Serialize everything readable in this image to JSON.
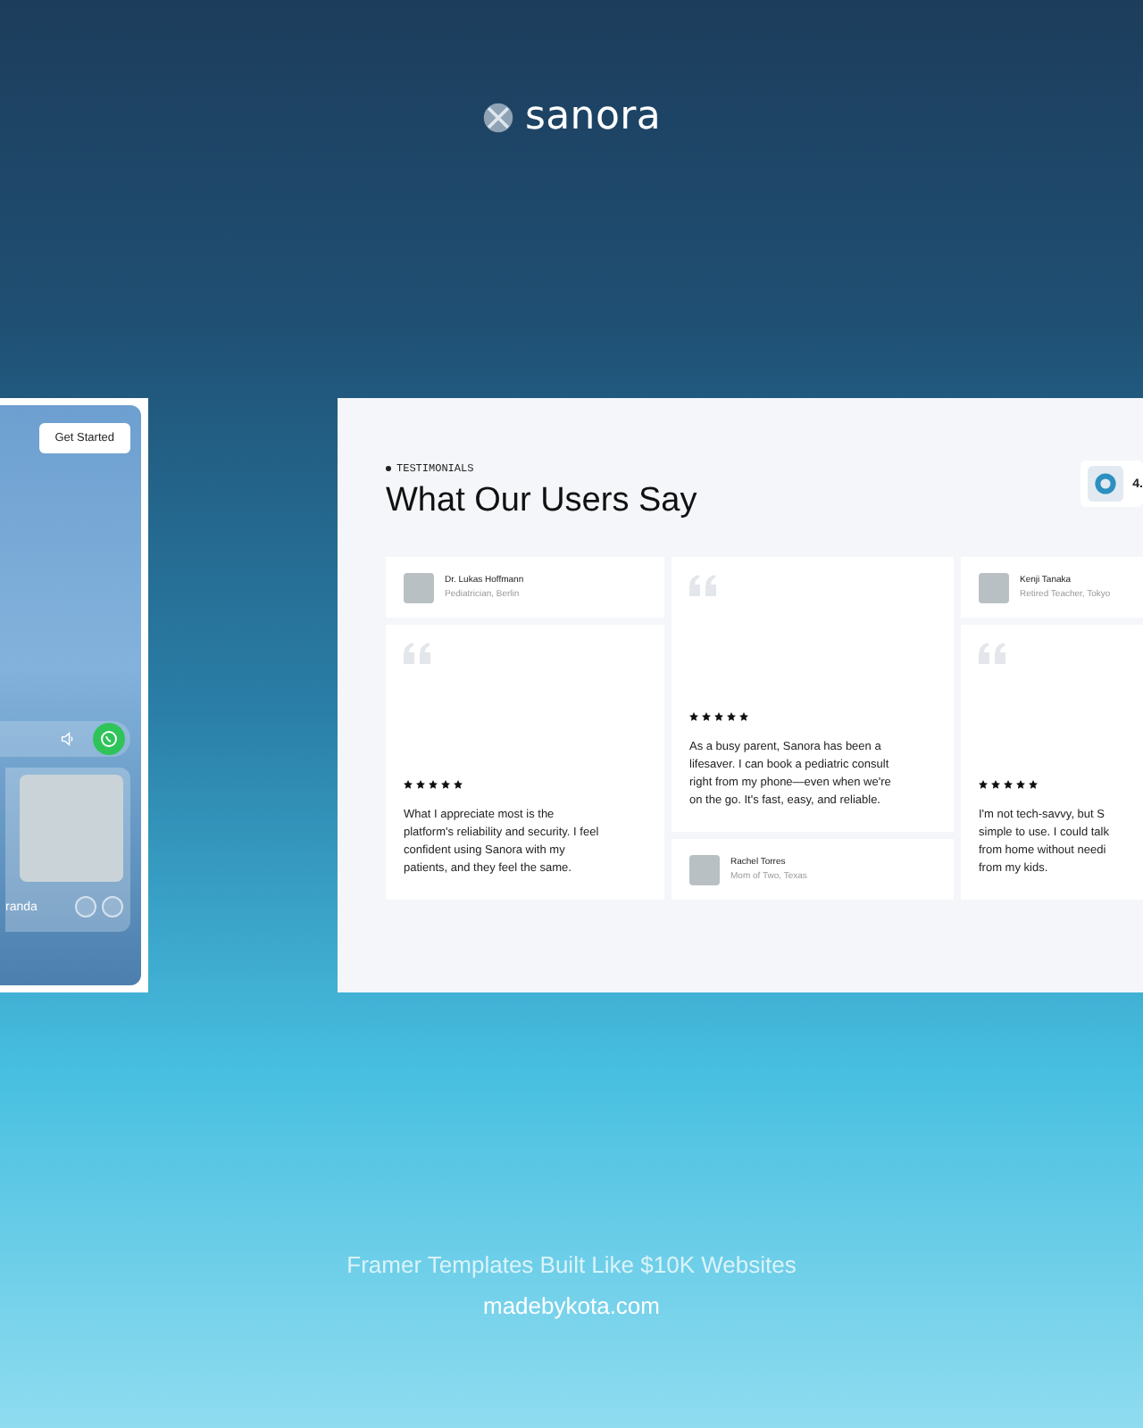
{
  "brand": {
    "name": "sanora"
  },
  "left_preview": {
    "button": "Get Started",
    "call_name": "randa"
  },
  "testimonials": {
    "eyebrow": "TESTIMONIALS",
    "title": "What Our Users Say",
    "rating": "4.",
    "columns": [
      {
        "cards": [
          {
            "kind": "author",
            "name": "Dr. Lukas Hoffmann",
            "role": "Pediatrician, Berlin"
          },
          {
            "kind": "quote",
            "stars": 5,
            "lines": [
              "What I appreciate most is the",
              "platform's reliability and security. I feel",
              "confident using Sanora with my",
              "patients, and they feel the same."
            ]
          }
        ]
      },
      {
        "cards": [
          {
            "kind": "quote",
            "stars": 5,
            "lines": [
              "As a busy parent, Sanora has been a",
              "lifesaver. I can book a pediatric consult",
              "right from my phone—even when we're",
              "on the go. It's fast, easy, and reliable."
            ]
          },
          {
            "kind": "author",
            "name": "Rachel Torres",
            "role": "Mom of Two, Texas"
          }
        ]
      },
      {
        "cards": [
          {
            "kind": "author",
            "name": "Kenji Tanaka",
            "role": "Retired Teacher, Tokyo"
          },
          {
            "kind": "quote",
            "stars": 5,
            "lines": [
              "I'm not tech-savvy, but S",
              "simple to use. I could talk",
              "from home without needi",
              "from my kids."
            ]
          }
        ]
      }
    ]
  },
  "footer": {
    "tagline": "Framer Templates Built Like $10K Websites",
    "site": "madebykota.com"
  }
}
